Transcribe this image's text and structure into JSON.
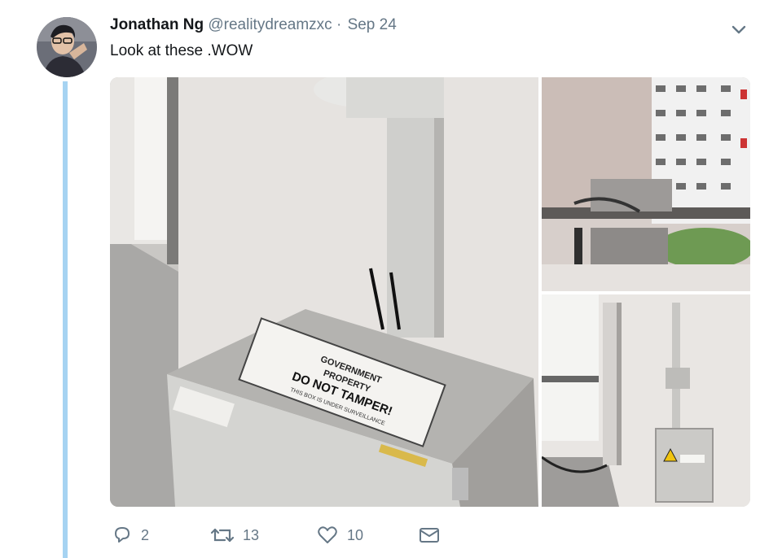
{
  "tweet": {
    "author_name": "Jonathan Ng",
    "handle": "@realitydreamzxc",
    "separator": "·",
    "date": "Sep 24",
    "text": "Look at these .WOW"
  },
  "media": {
    "photo1": {
      "sign_line1": "GOVERNMENT",
      "sign_line2": "PROPERTY",
      "sign_line3": "DO NOT TAMPER!",
      "sign_line4": "THIS BOX IS UNDER SURVEILLANCE"
    }
  },
  "actions": {
    "reply_count": "2",
    "retweet_count": "13",
    "like_count": "10"
  },
  "icons": {
    "reply": "reply-icon",
    "retweet": "retweet-icon",
    "like": "heart-icon",
    "message": "envelope-icon",
    "more": "chevron-down-icon"
  }
}
